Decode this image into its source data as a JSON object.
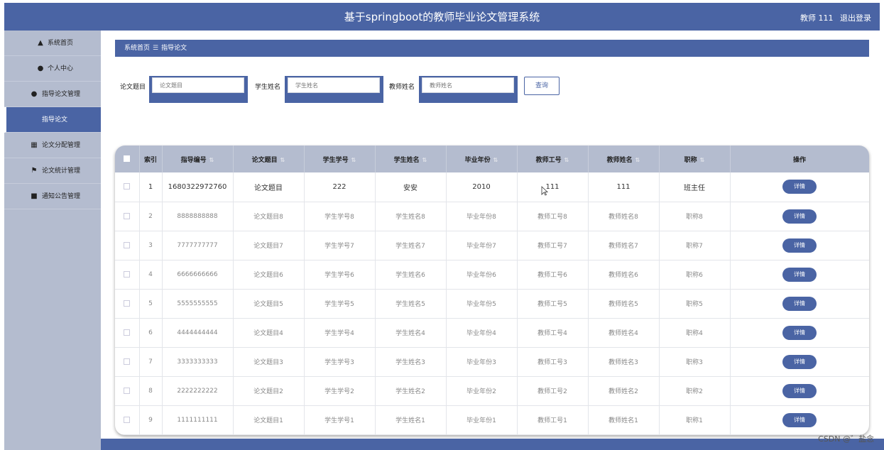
{
  "header": {
    "title": "基于springboot的教师毕业论文管理系统",
    "user": "教师 111",
    "logout": "退出登录"
  },
  "sidebar": {
    "home": "系统首页",
    "profile": "个人中心",
    "guide_mgmt": "指导论文管理",
    "guide_sub": "指导论文",
    "assign_mgmt": "论文分配管理",
    "stats_mgmt": "论文统计管理",
    "notice_mgmt": "通知公告管理"
  },
  "breadcrumb": {
    "home": "系统首页",
    "sep": "☰",
    "current": "指导论文"
  },
  "filters": {
    "title_label": "论文题目",
    "title_placeholder": "论文题目",
    "student_label": "学生姓名",
    "student_placeholder": "学生姓名",
    "teacher_label": "教师姓名",
    "teacher_placeholder": "教师姓名",
    "query": "查询"
  },
  "table": {
    "headers": [
      "索引",
      "指导编号",
      "论文题目",
      "学生学号",
      "学生姓名",
      "毕业年份",
      "教师工号",
      "教师姓名",
      "职称",
      "操作"
    ],
    "detail_label": "详情",
    "rows": [
      [
        "1",
        "1680322972760",
        "论文题目",
        "222",
        "安安",
        "2010",
        "111",
        "111",
        "班主任"
      ],
      [
        "2",
        "8888888888",
        "论文题目8",
        "学生学号8",
        "学生姓名8",
        "毕业年份8",
        "教师工号8",
        "教师姓名8",
        "职称8"
      ],
      [
        "3",
        "7777777777",
        "论文题目7",
        "学生学号7",
        "学生姓名7",
        "毕业年份7",
        "教师工号7",
        "教师姓名7",
        "职称7"
      ],
      [
        "4",
        "6666666666",
        "论文题目6",
        "学生学号6",
        "学生姓名6",
        "毕业年份6",
        "教师工号6",
        "教师姓名6",
        "职称6"
      ],
      [
        "5",
        "5555555555",
        "论文题目5",
        "学生学号5",
        "学生姓名5",
        "毕业年份5",
        "教师工号5",
        "教师姓名5",
        "职称5"
      ],
      [
        "6",
        "4444444444",
        "论文题目4",
        "学生学号4",
        "学生姓名4",
        "毕业年份4",
        "教师工号4",
        "教师姓名4",
        "职称4"
      ],
      [
        "7",
        "3333333333",
        "论文题目3",
        "学生学号3",
        "学生姓名3",
        "毕业年份3",
        "教师工号3",
        "教师姓名3",
        "职称3"
      ],
      [
        "8",
        "2222222222",
        "论文题目2",
        "学生学号2",
        "学生姓名2",
        "毕业年份2",
        "教师工号2",
        "教师姓名2",
        "职称2"
      ],
      [
        "9",
        "1111111111",
        "论文题目1",
        "学生学号1",
        "学生姓名1",
        "毕业年份1",
        "教师工号1",
        "教师姓名1",
        "职称1"
      ]
    ]
  },
  "watermark": "CSDN @゛盐念"
}
